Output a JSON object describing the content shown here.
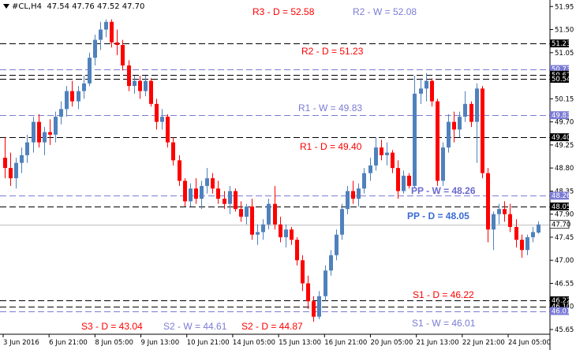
{
  "header": {
    "symbol": "#CL,H4",
    "ohlc": "47.54 47.76 47.52 47.70"
  },
  "colors": {
    "up": "#4f81bd",
    "down": "#ff0000",
    "daily_line": "#000000",
    "weekly_line": "#7b7bd6",
    "daily_label": "#ff0000",
    "weekly_label": "#7b7bd6",
    "pp_weekly_label": "#6a6ad0",
    "pp_daily_label": "#3a6bd6",
    "axis_text": "#000000",
    "price_badge_bg": "#000000",
    "weekly_badge_bg": "#7b7bd6",
    "current_badge_bg": "#ffffff"
  },
  "chart_data": {
    "type": "candlestick",
    "symbol": "#CL",
    "timeframe": "H4",
    "ylim": [
      45.65,
      52.0
    ],
    "y_ticks": [
      "51.95",
      "51.50",
      "51.05",
      "50.15",
      "49.70",
      "49.25",
      "48.80",
      "48.35",
      "47.90",
      "47.45",
      "47.00",
      "46.55",
      "46.10",
      "45.65"
    ],
    "x_ticks": [
      "3 Jun 2016",
      "6 Jun 21:00",
      "8 Jun 05:00",
      "9 Jun 13:00",
      "10 Jun 21:00",
      "14 Jun 05:00",
      "15 Jun 13:00",
      "16 Jun 21:00",
      "20 Jun 05:00",
      "21 Jun 13:00",
      "22 Jun 21:00",
      "24 Jun 05:00"
    ],
    "current_price": 47.7,
    "levels": [
      {
        "label": "R3 - D = 52.58",
        "value": 52.58,
        "kind": "daily",
        "show_badge": false
      },
      {
        "label": "R2 - W = 52.08",
        "value": 52.08,
        "kind": "weekly",
        "show_badge": false
      },
      {
        "label": "R2 - D = 51.23",
        "value": 51.23,
        "kind": "daily",
        "show_badge": true,
        "badge": "51.23"
      },
      {
        "label": "",
        "value": 50.73,
        "kind": "weekly",
        "show_badge": true,
        "badge": "50.73"
      },
      {
        "label": "",
        "value": 50.62,
        "kind": "daily",
        "show_badge": true,
        "badge": "50.62"
      },
      {
        "label": "",
        "value": 50.54,
        "kind": "daily",
        "show_badge": true,
        "badge": "50.54"
      },
      {
        "label": "R1 - W = 49.83",
        "value": 49.83,
        "kind": "weekly",
        "show_badge": true,
        "badge": "49.83"
      },
      {
        "label": "R1 - D = 49.40",
        "value": 49.4,
        "kind": "daily",
        "show_badge": true,
        "badge": "49.40"
      },
      {
        "label": "PP - W = 48.26",
        "value": 48.26,
        "kind": "weekly",
        "show_badge": true,
        "badge": "48.26",
        "bold": true
      },
      {
        "label": "PP - D = 48.05",
        "value": 48.05,
        "kind": "daily",
        "show_badge": true,
        "badge": "48.05",
        "bold": true
      },
      {
        "label": "S1 - D = 46.22",
        "value": 46.22,
        "kind": "daily",
        "show_badge": true,
        "badge": "46.22"
      },
      {
        "label": "",
        "value": 46.1,
        "kind": "daily",
        "show_badge": true,
        "badge": "46.10"
      },
      {
        "label": "S1 - W = 46.01",
        "value": 46.01,
        "kind": "weekly",
        "show_badge": true,
        "badge": "46.01"
      },
      {
        "label": "S3 - D = 43.04",
        "value": 43.04,
        "kind": "daily",
        "show_badge": false
      },
      {
        "label": "S2 - W = 44.61",
        "value": 44.61,
        "kind": "weekly",
        "show_badge": false
      },
      {
        "label": "S2 - D = 44.87",
        "value": 44.87,
        "kind": "daily",
        "show_badge": false
      }
    ],
    "candles": [
      [
        49.0,
        49.4,
        48.6,
        48.8
      ],
      [
        48.8,
        49.1,
        48.45,
        48.6
      ],
      [
        48.6,
        49.0,
        48.4,
        48.9
      ],
      [
        48.9,
        49.2,
        48.7,
        49.05
      ],
      [
        49.05,
        49.45,
        48.9,
        49.3
      ],
      [
        49.3,
        49.8,
        49.1,
        49.7
      ],
      [
        49.7,
        49.85,
        49.2,
        49.3
      ],
      [
        49.3,
        49.6,
        49.05,
        49.5
      ],
      [
        49.5,
        49.75,
        49.25,
        49.45
      ],
      [
        49.45,
        49.9,
        49.3,
        49.8
      ],
      [
        49.8,
        50.1,
        49.65,
        49.95
      ],
      [
        49.95,
        50.4,
        49.8,
        50.3
      ],
      [
        50.3,
        50.5,
        50.0,
        50.1
      ],
      [
        50.1,
        50.4,
        49.95,
        50.3
      ],
      [
        50.3,
        50.6,
        50.15,
        50.45
      ],
      [
        50.45,
        51.05,
        50.4,
        50.95
      ],
      [
        50.95,
        51.4,
        50.8,
        51.3
      ],
      [
        51.3,
        51.65,
        51.1,
        51.5
      ],
      [
        51.5,
        51.7,
        51.35,
        51.65
      ],
      [
        51.65,
        51.7,
        51.15,
        51.25
      ],
      [
        51.25,
        51.5,
        51.0,
        51.2
      ],
      [
        51.2,
        51.3,
        50.7,
        50.8
      ],
      [
        50.8,
        50.9,
        50.3,
        50.4
      ],
      [
        50.4,
        50.6,
        50.25,
        50.5
      ],
      [
        50.5,
        50.6,
        50.15,
        50.3
      ],
      [
        50.3,
        50.6,
        50.2,
        50.5
      ],
      [
        50.5,
        50.55,
        50.0,
        50.05
      ],
      [
        50.05,
        50.15,
        49.55,
        49.7
      ],
      [
        49.7,
        49.95,
        49.55,
        49.8
      ],
      [
        49.8,
        49.85,
        49.2,
        49.3
      ],
      [
        49.3,
        49.4,
        48.85,
        48.95
      ],
      [
        48.95,
        49.05,
        48.45,
        48.55
      ],
      [
        48.55,
        48.6,
        48.05,
        48.15
      ],
      [
        48.15,
        48.5,
        48.05,
        48.4
      ],
      [
        48.4,
        48.6,
        48.1,
        48.2
      ],
      [
        48.2,
        48.55,
        48.0,
        48.45
      ],
      [
        48.45,
        48.8,
        48.3,
        48.6
      ],
      [
        48.6,
        48.7,
        48.3,
        48.4
      ],
      [
        48.4,
        48.55,
        48.1,
        48.2
      ],
      [
        48.2,
        48.35,
        48.0,
        48.1
      ],
      [
        48.1,
        48.45,
        47.9,
        48.35
      ],
      [
        48.35,
        48.4,
        47.95,
        48.0
      ],
      [
        48.0,
        48.15,
        47.75,
        47.85
      ],
      [
        47.85,
        48.1,
        47.7,
        48.05
      ],
      [
        48.05,
        48.2,
        47.4,
        47.5
      ],
      [
        47.5,
        47.7,
        47.3,
        47.55
      ],
      [
        47.55,
        47.8,
        47.4,
        47.7
      ],
      [
        47.7,
        48.2,
        47.6,
        48.1
      ],
      [
        48.1,
        48.45,
        47.6,
        47.7
      ],
      [
        47.7,
        47.85,
        47.35,
        47.45
      ],
      [
        47.45,
        47.7,
        47.25,
        47.6
      ],
      [
        47.6,
        47.65,
        47.3,
        47.4
      ],
      [
        47.4,
        47.45,
        46.9,
        47.0
      ],
      [
        47.0,
        47.1,
        46.4,
        46.55
      ],
      [
        46.55,
        46.7,
        46.05,
        46.2
      ],
      [
        46.2,
        46.3,
        45.8,
        45.9
      ],
      [
        45.9,
        46.4,
        45.85,
        46.3
      ],
      [
        46.3,
        46.9,
        46.2,
        46.8
      ],
      [
        46.8,
        47.2,
        46.7,
        47.1
      ],
      [
        47.1,
        47.6,
        47.0,
        47.5
      ],
      [
        47.5,
        48.1,
        47.4,
        48.0
      ],
      [
        48.0,
        48.45,
        47.9,
        48.35
      ],
      [
        48.35,
        48.55,
        48.1,
        48.2
      ],
      [
        48.2,
        48.5,
        48.05,
        48.4
      ],
      [
        48.4,
        48.8,
        48.3,
        48.7
      ],
      [
        48.7,
        49.0,
        48.55,
        48.85
      ],
      [
        48.85,
        49.4,
        48.75,
        49.2
      ],
      [
        49.2,
        49.35,
        48.95,
        49.05
      ],
      [
        49.05,
        49.3,
        48.85,
        49.1
      ],
      [
        49.1,
        49.15,
        48.7,
        48.8
      ],
      [
        48.8,
        48.95,
        48.2,
        48.35
      ],
      [
        48.35,
        48.75,
        48.3,
        48.65
      ],
      [
        48.65,
        48.7,
        48.4,
        48.45
      ],
      [
        48.45,
        50.6,
        48.4,
        50.25
      ],
      [
        50.25,
        50.55,
        50.05,
        50.35
      ],
      [
        50.35,
        50.65,
        50.1,
        50.5
      ],
      [
        50.5,
        50.55,
        50.0,
        50.1
      ],
      [
        50.1,
        50.15,
        48.45,
        48.55
      ],
      [
        48.55,
        49.3,
        48.45,
        49.2
      ],
      [
        49.2,
        49.85,
        49.1,
        49.7
      ],
      [
        49.7,
        49.9,
        49.3,
        49.55
      ],
      [
        49.55,
        49.9,
        49.4,
        49.8
      ],
      [
        49.8,
        50.3,
        49.7,
        50.05
      ],
      [
        50.05,
        50.1,
        49.6,
        49.7
      ],
      [
        49.7,
        50.45,
        48.9,
        50.35
      ],
      [
        50.35,
        50.4,
        48.6,
        48.7
      ],
      [
        48.7,
        48.8,
        47.35,
        47.6
      ],
      [
        47.6,
        47.95,
        47.2,
        47.9
      ],
      [
        47.9,
        48.1,
        47.7,
        48.0
      ],
      [
        48.0,
        48.15,
        47.75,
        47.9
      ],
      [
        47.9,
        48.1,
        47.55,
        47.65
      ],
      [
        47.65,
        47.8,
        47.25,
        47.4
      ],
      [
        47.4,
        47.5,
        47.05,
        47.2
      ],
      [
        47.2,
        47.5,
        47.1,
        47.45
      ],
      [
        47.45,
        47.65,
        47.35,
        47.55
      ],
      [
        47.54,
        47.76,
        47.52,
        47.7
      ]
    ]
  }
}
